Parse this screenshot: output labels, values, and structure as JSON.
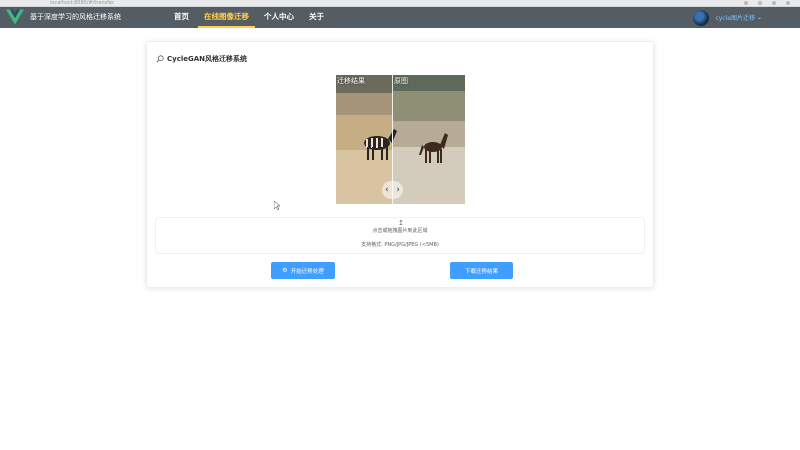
{
  "browser": {
    "url": "localhost:8080/#/transfer"
  },
  "navbar": {
    "app_title": "基于深度学习的风格迁移系统",
    "items": [
      {
        "label": "首页",
        "active": false
      },
      {
        "label": "在线图像迁移",
        "active": true
      },
      {
        "label": "个人中心",
        "active": false
      },
      {
        "label": "关于",
        "active": false
      }
    ],
    "username": "cycle图片迁移",
    "user_caret": "⌄"
  },
  "card": {
    "title": "CycleGAN风格迁移系统",
    "compare": {
      "left_label": "迁移结果",
      "right_label": "原图",
      "prev_glyph": "‹",
      "next_glyph": "›"
    },
    "upload": {
      "icon_glyph": "↥",
      "text": "点击或拖拽图片到此区域",
      "tip": "支持格式: PNG/JPG/JPEG (<5MB)"
    },
    "buttons": {
      "start_icon": "⚙",
      "start_label": "开始迁移处理",
      "download_label": "下载迁移结果"
    }
  },
  "colors": {
    "navbar_bg": "#545c64",
    "nav_active": "#ffd04b",
    "primary": "#409eff"
  }
}
